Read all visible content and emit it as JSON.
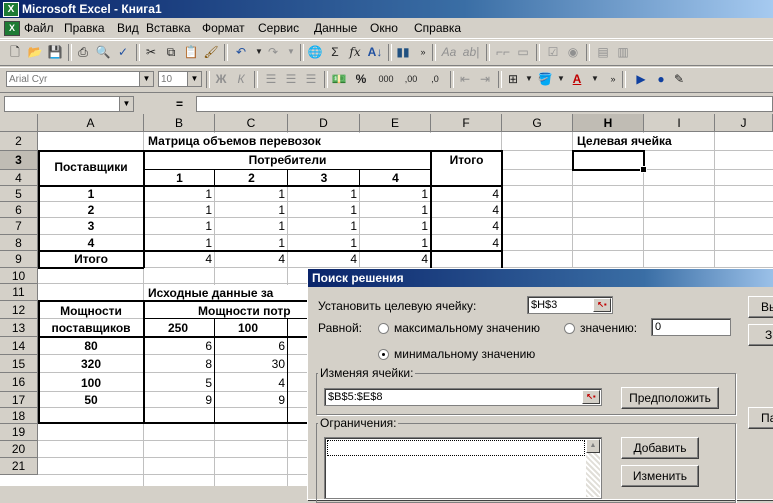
{
  "window": {
    "title": "Microsoft Excel - Книга1"
  },
  "menu": [
    "Файл",
    "Правка",
    "Вид",
    "Вставка",
    "Формат",
    "Сервис",
    "Данные",
    "Окно",
    "Справка"
  ],
  "format_toolbar": {
    "font": "Arial Cyr",
    "size": "10",
    "bold": "Ж",
    "italic": "К",
    "percent": "%",
    "thousands": "000",
    "inc_dec": ",00",
    "dec_dec": ",0"
  },
  "formula_bar": {
    "equals": "="
  },
  "columns": [
    "A",
    "B",
    "C",
    "D",
    "E",
    "F",
    "G",
    "H",
    "I",
    "J"
  ],
  "rows": [
    "2",
    "3",
    "4",
    "5",
    "6",
    "7",
    "8",
    "9",
    "10",
    "11",
    "12",
    "13",
    "14",
    "15",
    "16",
    "17",
    "18",
    "19",
    "20",
    "21"
  ],
  "sheet": {
    "title": "Матрица объемов перевозок",
    "suppliers": "Поставщики",
    "consumers": "Потребители",
    "total_col": "Итого",
    "consumer_nums": [
      "1",
      "2",
      "3",
      "4"
    ],
    "supplier_nums": [
      "1",
      "2",
      "3",
      "4"
    ],
    "matrix": [
      [
        "1",
        "1",
        "1",
        "1",
        "4"
      ],
      [
        "1",
        "1",
        "1",
        "1",
        "4"
      ],
      [
        "1",
        "1",
        "1",
        "1",
        "4"
      ],
      [
        "1",
        "1",
        "1",
        "1",
        "4"
      ]
    ],
    "total_row": "Итого",
    "total_values": [
      "4",
      "4",
      "4",
      "4"
    ],
    "target_label": "Целевая ячейка",
    "source_title": "Исходные данные за",
    "cap_header1": "Мощности",
    "cap_header2": "поставщиков",
    "cons_cap_header": "Мощности потр",
    "cons_caps": [
      "250",
      "100"
    ],
    "supplier_caps": [
      "80",
      "320",
      "100",
      "50"
    ],
    "costs": [
      [
        "6",
        "6"
      ],
      [
        "8",
        "30"
      ],
      [
        "5",
        "4"
      ],
      [
        "9",
        "9"
      ]
    ]
  },
  "dialog": {
    "title": "Поиск решения",
    "target_label": "Установить целевую ячейку:",
    "target_value": "$H$3",
    "equal_label": "Равной:",
    "opt_max": "максимальному значению",
    "opt_value": "значению:",
    "value_field": "0",
    "opt_min": "минимальному значению",
    "changing_label": "Изменяя ячейки:",
    "changing_value": "$B$5:$E$8",
    "guess_button": "Предположить",
    "constraints_label": "Ограничения:",
    "add_button": "Добавить",
    "change_button": "Изменить",
    "right_btn1": "Вы",
    "right_btn2": "З",
    "right_btn3": "Па"
  }
}
